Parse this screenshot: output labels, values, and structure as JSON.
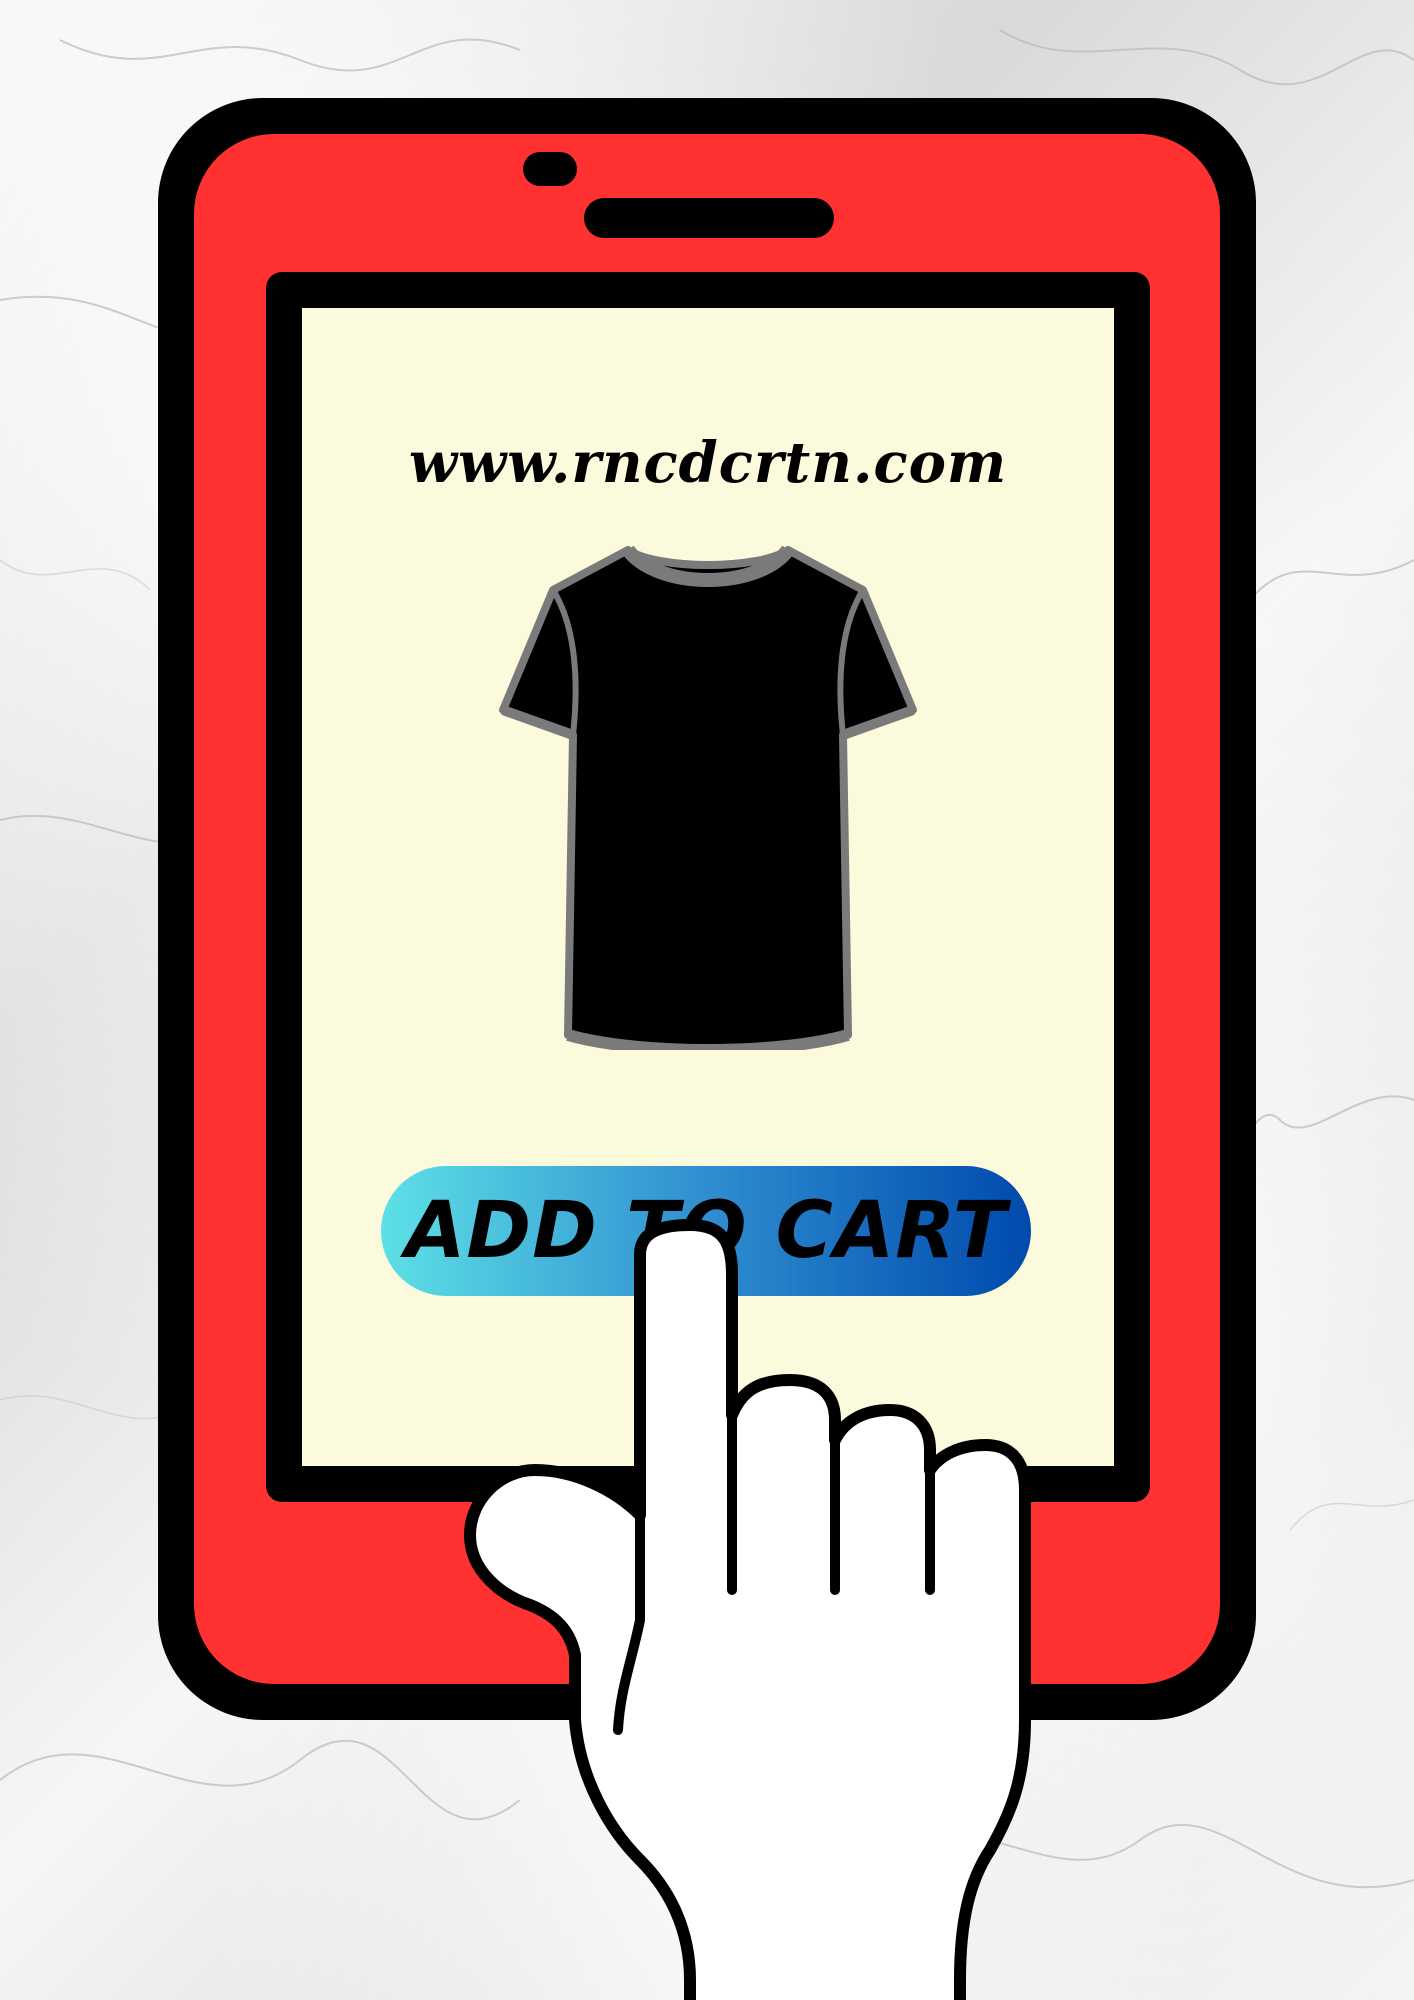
{
  "site": {
    "url": "www.rncdcrtn.com"
  },
  "product": {
    "icon": "tshirt-icon",
    "body_color": "#000000",
    "trim_color": "#7a7a7a"
  },
  "cart_button": {
    "label": "ADD TO CART",
    "gradient_start": "#5de0e6",
    "gradient_end": "#004aad"
  },
  "device": {
    "frame_color": "#ff3131",
    "screen_color": "#fcfadc"
  },
  "pointer": {
    "icon": "pointing-hand-icon"
  }
}
